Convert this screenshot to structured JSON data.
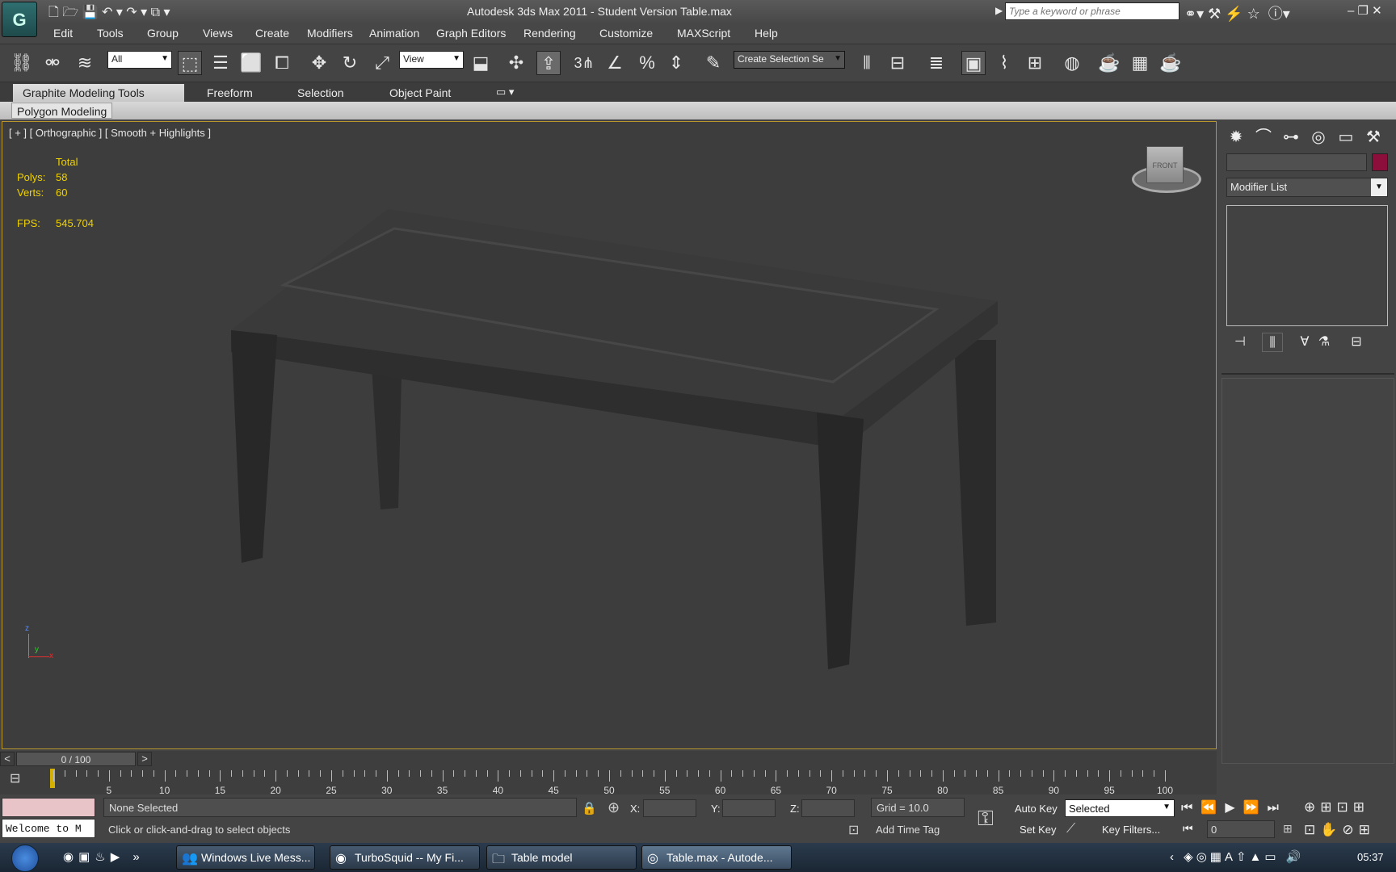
{
  "title_bar": {
    "title": "Autodesk 3ds Max  2011  - Student Version    Table.max",
    "search_placeholder": "Type a keyword or phrase"
  },
  "menu": [
    "Edit",
    "Tools",
    "Group",
    "Views",
    "Create",
    "Modifiers",
    "Animation",
    "Graph Editors",
    "Rendering",
    "Customize",
    "MAXScript",
    "Help"
  ],
  "toolbar": {
    "selection_filter": "All",
    "ref_coord": "View",
    "named_selection": "Create Selection Se",
    "snap_label": "3"
  },
  "ribbon": {
    "tabs": [
      "Graphite Modeling Tools",
      "Freeform",
      "Selection",
      "Object Paint"
    ],
    "sub_tab": "Polygon Modeling"
  },
  "viewport": {
    "label": "[ + ] [ Orthographic ] [ Smooth + Highlights ]",
    "stats": {
      "header": "Total",
      "polys_label": "Polys:",
      "polys_value": "58",
      "verts_label": "Verts:",
      "verts_value": "60",
      "fps_label": "FPS:",
      "fps_value": "545.704"
    },
    "viewcube_face": "FRONT",
    "axis": {
      "z": "z",
      "y": "y",
      "x": "x"
    }
  },
  "command_panel": {
    "modifier_list": "Modifier List",
    "color": "#8b0f3a"
  },
  "time_slider": {
    "position": "0 / 100",
    "prev": "<",
    "next": ">"
  },
  "timeline": {
    "ticks": [
      "5",
      "10",
      "15",
      "20",
      "25",
      "30",
      "35",
      "40",
      "45",
      "50",
      "55",
      "60",
      "65",
      "70",
      "75",
      "80",
      "85",
      "90",
      "95",
      "100"
    ]
  },
  "status": {
    "maxscript": "Welcome to M",
    "selection": "None Selected",
    "prompt": "Click or click-and-drag to select objects",
    "x_label": "X:",
    "y_label": "Y:",
    "z_label": "Z:",
    "grid": "Grid = 10.0",
    "add_time_tag": "Add Time Tag",
    "auto_key": "Auto Key",
    "set_key": "Set Key",
    "key_mode": "Selected",
    "key_filters": "Key Filters...",
    "frame": "0"
  },
  "taskbar": {
    "tasks": [
      "Windows Live Mess...",
      "TurboSquid -- My Fi...",
      "Table model",
      "Table.max - Autode..."
    ],
    "clock": "05:37"
  }
}
